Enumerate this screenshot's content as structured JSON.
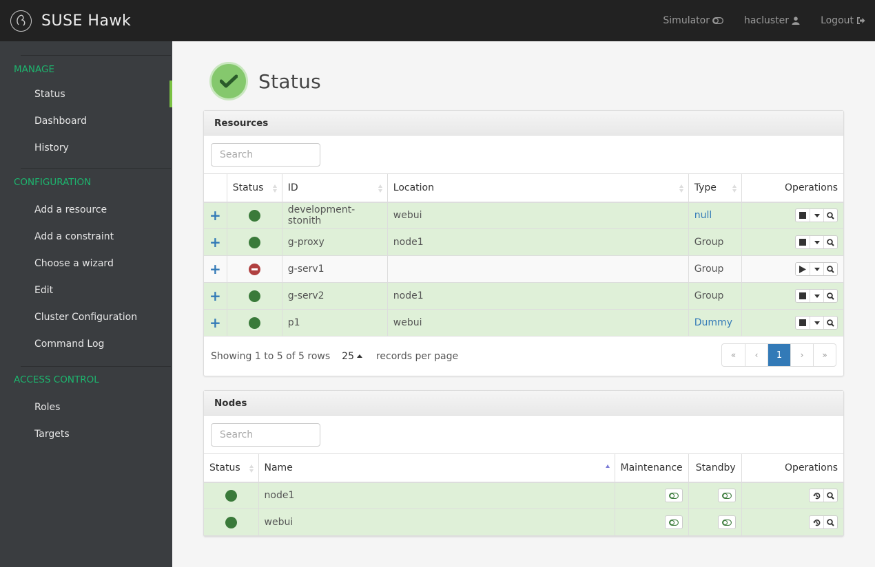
{
  "app": {
    "title": "SUSE Hawk"
  },
  "topnav": {
    "simulator": "Simulator",
    "user": "hacluster",
    "logout": "Logout"
  },
  "sidebar": {
    "sections": [
      {
        "title": "MANAGE",
        "items": [
          {
            "label": "Status",
            "active": true
          },
          {
            "label": "Dashboard"
          },
          {
            "label": "History"
          }
        ]
      },
      {
        "title": "CONFIGURATION",
        "items": [
          {
            "label": "Add a resource"
          },
          {
            "label": "Add a constraint"
          },
          {
            "label": "Choose a wizard"
          },
          {
            "label": "Edit"
          },
          {
            "label": "Cluster Configuration"
          },
          {
            "label": "Command Log"
          }
        ]
      },
      {
        "title": "ACCESS CONTROL",
        "items": [
          {
            "label": "Roles"
          },
          {
            "label": "Targets"
          }
        ]
      }
    ]
  },
  "page": {
    "title": "Status",
    "status_icon": "check-icon"
  },
  "resources": {
    "heading": "Resources",
    "search_placeholder": "Search",
    "columns": [
      "",
      "Status",
      "ID",
      "Location",
      "Type",
      "Operations"
    ],
    "rows": [
      {
        "status": "running",
        "id": "development-stonith",
        "location": "webui",
        "type": "null",
        "type_link": true,
        "op": "stop"
      },
      {
        "status": "running",
        "id": "g-proxy",
        "location": "node1",
        "type": "Group",
        "type_link": false,
        "op": "stop"
      },
      {
        "status": "stopped",
        "id": "g-serv1",
        "location": "",
        "type": "Group",
        "type_link": false,
        "op": "start"
      },
      {
        "status": "running",
        "id": "g-serv2",
        "location": "node1",
        "type": "Group",
        "type_link": false,
        "op": "stop"
      },
      {
        "status": "running",
        "id": "p1",
        "location": "webui",
        "type": "Dummy",
        "type_link": true,
        "op": "stop"
      }
    ],
    "footer": {
      "showing": "Showing 1 to 5 of 5 rows",
      "per_page": "25",
      "per_page_label": "records per page"
    },
    "pagination": {
      "first": "«",
      "prev": "‹",
      "current": "1",
      "next": "›",
      "last": "»"
    }
  },
  "nodes": {
    "heading": "Nodes",
    "search_placeholder": "Search",
    "columns": [
      "Status",
      "Name",
      "Maintenance",
      "Standby",
      "Operations"
    ],
    "rows": [
      {
        "status": "online",
        "name": "node1"
      },
      {
        "status": "online",
        "name": "webui"
      }
    ]
  },
  "colors": {
    "accent": "#7ac143",
    "section": "#1db56e",
    "link": "#337ab7",
    "ok_row": "#dff0d8",
    "running": "#3a7a3a",
    "stopped": "#b04040"
  }
}
